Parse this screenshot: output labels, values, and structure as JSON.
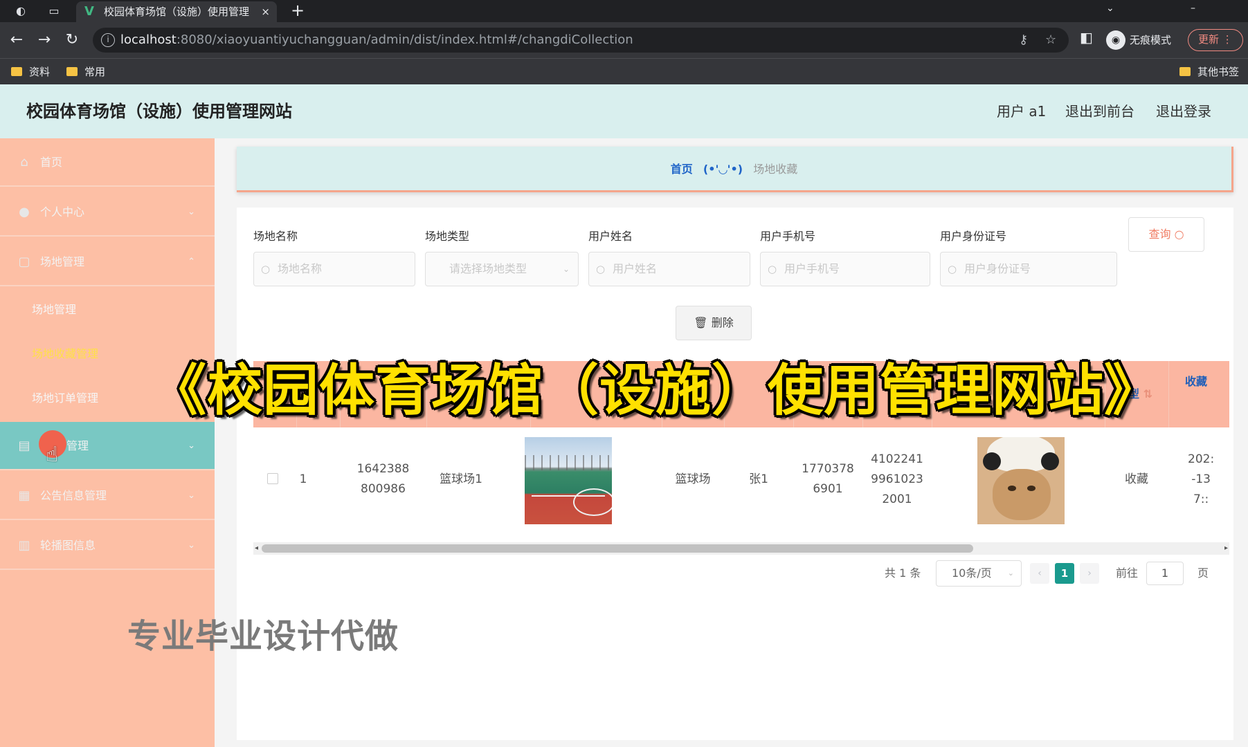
{
  "browser": {
    "tab_title": "校园体育场馆（设施）使用管理",
    "tab_close": "×",
    "new_tab": "+",
    "url_host": "localhost",
    "url_rest": ":8080/xiaoyuantiyuchangguan/admin/dist/index.html#/changdiCollection",
    "incognito_label": "无痕模式",
    "update_label": "更新",
    "bookmarks": [
      "资料",
      "常用"
    ],
    "other_bookmarks": "其他书签"
  },
  "header": {
    "title": "校园体育场馆（设施）使用管理网站",
    "user": "用户 a1",
    "to_front": "退出到前台",
    "logout": "退出登录"
  },
  "sidebar": {
    "items": [
      {
        "label": "首页",
        "icon": "home-icon"
      },
      {
        "label": "个人中心",
        "icon": "user-icon",
        "caret": "⌄"
      },
      {
        "label": "场地管理",
        "icon": "venue-icon",
        "caret": "⌃"
      },
      {
        "label": "管理",
        "icon": "briefcase-icon",
        "caret": "⌄"
      },
      {
        "label": "公告信息管理",
        "icon": "grid-icon",
        "caret": "⌄"
      },
      {
        "label": "轮播图信息",
        "icon": "clipboard-icon",
        "caret": "⌄"
      }
    ],
    "submenu": [
      "场地管理",
      "场地收藏管理",
      "场地订单管理"
    ]
  },
  "breadcrumb": {
    "home": "首页",
    "sep": "(•'◡'•)",
    "current": "场地收藏"
  },
  "filters": {
    "labels": [
      "场地名称",
      "场地类型",
      "用户姓名",
      "用户手机号",
      "用户身份证号"
    ],
    "placeholders": [
      "场地名称",
      "请选择场地类型",
      "用户姓名",
      "用户手机号",
      "用户身份证号"
    ],
    "query": "查询",
    "delete": "删除"
  },
  "table": {
    "headers": [
      "类型",
      "类型",
      "收藏"
    ],
    "row": {
      "index": "1",
      "number": "1642388\n800986",
      "venue_name": "篮球场1",
      "venue_type": "篮球场",
      "user_name": "张1",
      "phone": "1770378\n6901",
      "id_card": "4102241\n9961023\n2001",
      "collect_type": "收藏",
      "time": "202:\n-13\n7::"
    }
  },
  "pagination": {
    "total": "共 1 条",
    "page_size": "10条/页",
    "current": "1",
    "goto_label": "前往",
    "goto_value": "1",
    "page_suffix": "页"
  },
  "overlay": {
    "caption": "《校园体育场馆（设施）使用管理网站》",
    "promo": "专业毕业设计代做"
  }
}
